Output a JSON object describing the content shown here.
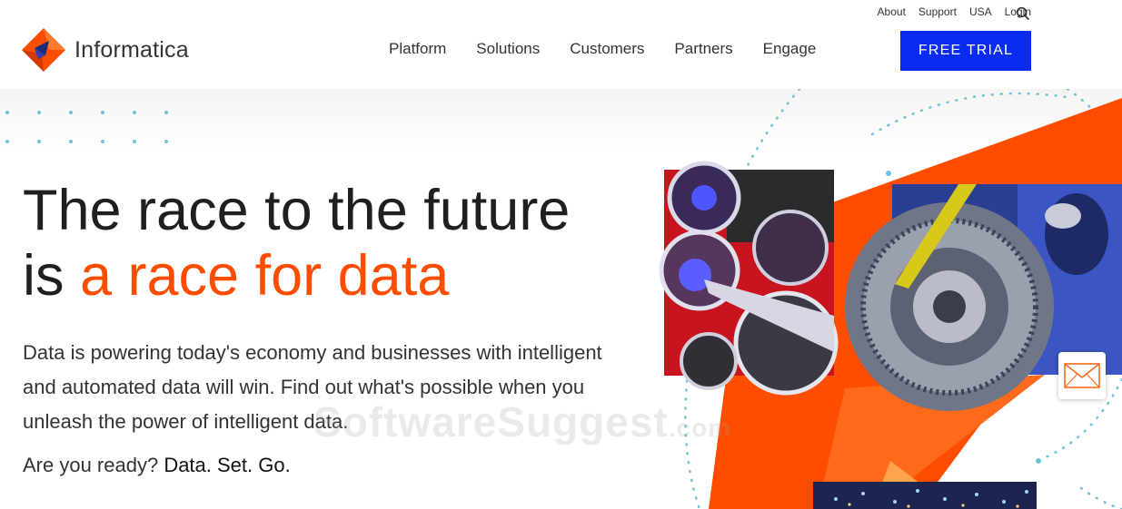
{
  "header": {
    "brand": "Informatica",
    "utility_links": [
      "About",
      "Support",
      "USA",
      "Login"
    ],
    "nav": [
      "Platform",
      "Solutions",
      "Customers",
      "Partners",
      "Engage"
    ],
    "cta": "FREE TRIAL"
  },
  "hero": {
    "headline_line1": "The race to the future",
    "headline_line2_prefix": "is ",
    "headline_line2_accent": "a race for data",
    "body": "Data is powering today's economy and businesses with intelligent and automated data will win. Find out what's possible when you unleash the power of intelligent data.",
    "question": "Are you ready? ",
    "question_bold": "Data. Set. Go."
  },
  "watermark": {
    "text": "SoftwareSuggest",
    "suffix": ".com"
  },
  "colors": {
    "accent": "#ff4d00",
    "cta": "#0a2bf0",
    "dots": "#6cc4d6"
  }
}
